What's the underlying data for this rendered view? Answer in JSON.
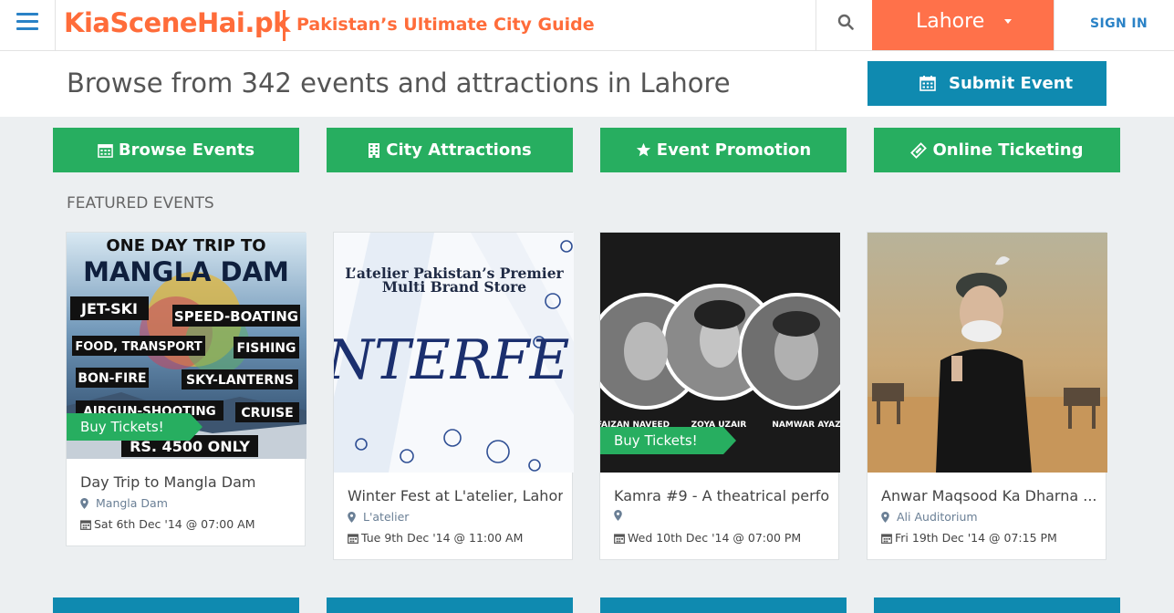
{
  "header": {
    "brand": "KiaSceneHai.pk",
    "tagline": "Pakistan’s Ultimate City Guide",
    "city": "Lahore",
    "signin": "SIGN IN"
  },
  "band": {
    "headline": "Browse from 342 events and attractions in Lahore",
    "submit": "Submit Event"
  },
  "nav": [
    {
      "label": "Browse Events",
      "icon": "calendar-icon"
    },
    {
      "label": "City Attractions",
      "icon": "building-icon"
    },
    {
      "label": "Event Promotion",
      "icon": "star-icon"
    },
    {
      "label": "Online Ticketing",
      "icon": "ticket-icon"
    }
  ],
  "featured": {
    "title": "FEATURED EVENTS",
    "ribbon": "Buy Tickets!",
    "cards": [
      {
        "title": "Day Trip to Mangla Dam",
        "venue": "Mangla Dam",
        "date": "Sat 6th Dec '14 @ 07:00 AM",
        "buy": true,
        "poster": {
          "l1": "ONE DAY TRIP TO",
          "l2": "MANGLA DAM",
          "t1": "JET-SKI",
          "t2": "SPEED-BOATING",
          "t3": "FOOD, TRANSPORT",
          "t4": "FISHING",
          "t5": "BON-FIRE",
          "t6": "SKY-LANTERNS",
          "t7": "AIRGUN-SHOOTING",
          "t8": "CRUISE",
          "price": "RS. 4500 ONLY"
        }
      },
      {
        "title": "Winter Fest at L'atelier, Lahore",
        "venue": "L'atelier",
        "date": "Tue 9th Dec '14 @ 11:00 AM",
        "buy": false,
        "poster": {
          "l1": "L’atelier Pakistan’s Premier",
          "l2": "Multi Brand Store",
          "big": "NTERFE"
        }
      },
      {
        "title": "Kamra #9 - A theatrical perfo...",
        "venue": "",
        "date": "Wed 10th Dec '14 @ 07:00 PM",
        "buy": true,
        "poster": {
          "n1": "FAIZAN NAVEED",
          "n2": "ZOYA UZAIR",
          "n3": "NAMWAR AYAZ"
        }
      },
      {
        "title": "Anwar Maqsood Ka Dharna ...",
        "venue": "Ali Auditorium",
        "date": "Fri 19th Dec '14 @ 07:15 PM",
        "buy": false,
        "poster": {}
      }
    ]
  },
  "colors": {
    "brand": "#ff6c3a",
    "city_bg": "#ff714a",
    "primary_blue": "#0f8ab0",
    "green": "#27ae60",
    "link_blue": "#2a82c6"
  }
}
